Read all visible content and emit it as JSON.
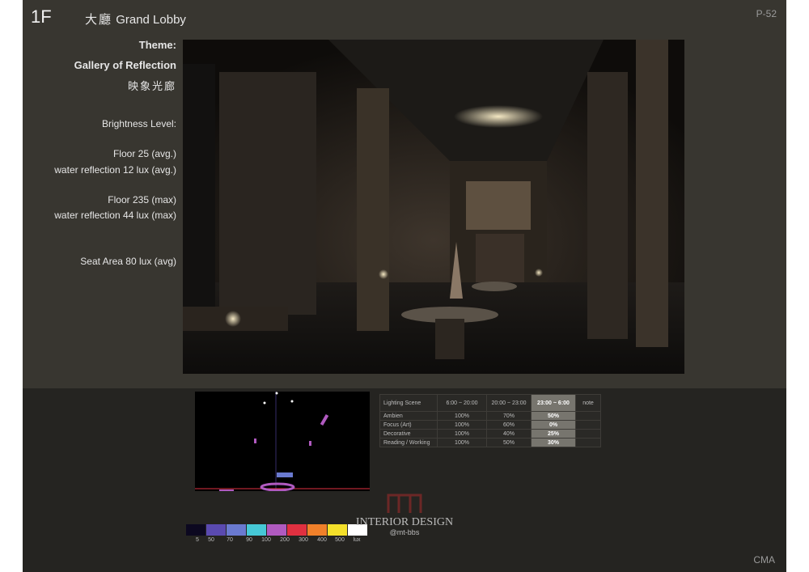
{
  "header": {
    "floor": "1F",
    "hall_cn": "大廳",
    "hall_en": "Grand Lobby",
    "page": "P-52"
  },
  "info": {
    "theme_label": "Theme:",
    "theme_title": "Gallery of Reflection",
    "theme_cn": "映象光廊",
    "brightness_label": "Brightness Level:",
    "floor_avg": "Floor 25 (avg.)",
    "water_avg": "water reflection  12 lux (avg.)",
    "floor_max": "Floor 235  (max)",
    "water_max": "water reflection  44 lux (max)",
    "seat": "Seat Area  80 lux (avg)"
  },
  "table": {
    "headers": [
      "Lighting Scene",
      "6:00 ~ 20:00",
      "20:00 ~ 23:00",
      "23:00 ~ 6:00",
      "note"
    ],
    "rows": [
      {
        "label": "Ambien",
        "c1": "100%",
        "c2": "70%",
        "c3": "50%"
      },
      {
        "label": "Focus  (Art)",
        "c1": "100%",
        "c2": "60%",
        "c3": "0%"
      },
      {
        "label": "Decorative",
        "c1": "100%",
        "c2": "40%",
        "c3": "25%"
      },
      {
        "label": "Reading / Working",
        "c1": "100%",
        "c2": "50%",
        "c3": "30%"
      }
    ]
  },
  "legend": {
    "labels": [
      "5",
      "50",
      "70",
      "90",
      "100",
      "200",
      "300",
      "400",
      "500",
      "lux"
    ],
    "colors": [
      "#0c0820",
      "#5a4ab0",
      "#6a7ad0",
      "#46c8d6",
      "#b05ac0",
      "#e03040",
      "#f0802a",
      "#f4e02a",
      "#ffffff"
    ]
  },
  "watermark": {
    "line1": "INTERIOR DESIGN",
    "line2": "@mt-bbs"
  },
  "footer": {
    "brand": "CMA"
  }
}
